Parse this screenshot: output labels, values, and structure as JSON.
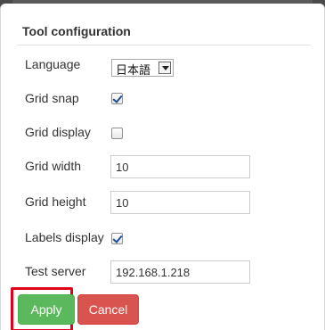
{
  "dialog": {
    "title": "Tool configuration"
  },
  "fields": {
    "language": {
      "label": "Language",
      "value": "日本語"
    },
    "grid_snap": {
      "label": "Grid snap",
      "checked": true
    },
    "grid_display": {
      "label": "Grid display",
      "checked": false
    },
    "grid_width": {
      "label": "Grid width",
      "value": "10"
    },
    "grid_height": {
      "label": "Grid height",
      "value": "10"
    },
    "labels_display": {
      "label": "Labels display",
      "checked": true
    },
    "test_server": {
      "label": "Test server",
      "value": "192.168.1.218"
    }
  },
  "buttons": {
    "apply": "Apply",
    "cancel": "Cancel"
  },
  "colors": {
    "apply": "#5cb85c",
    "cancel": "#d9534f",
    "highlight": "#e0001a"
  }
}
